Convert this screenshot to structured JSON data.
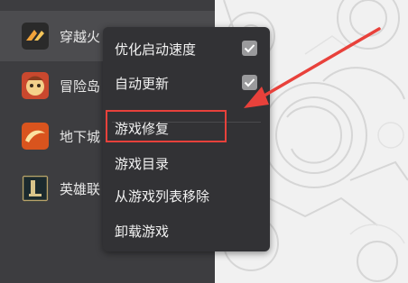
{
  "games": [
    {
      "label": "穿越火",
      "icon": "crossfire-icon",
      "selected": true
    },
    {
      "label": "冒险岛",
      "icon": "maplestory-icon",
      "selected": false
    },
    {
      "label": "地下城",
      "icon": "dnf-icon",
      "selected": false
    },
    {
      "label": "英雄联",
      "icon": "league-of-legends-icon",
      "selected": false
    }
  ],
  "menu": {
    "items": [
      {
        "label": "优化启动速度",
        "checked": true
      },
      {
        "label": "自动更新",
        "checked": true
      },
      {
        "label": "游戏修复"
      },
      {
        "label": "游戏目录"
      },
      {
        "label": "从游戏列表移除"
      },
      {
        "label": "卸载游戏"
      }
    ]
  },
  "annotation": {
    "color": "#e8413b"
  }
}
